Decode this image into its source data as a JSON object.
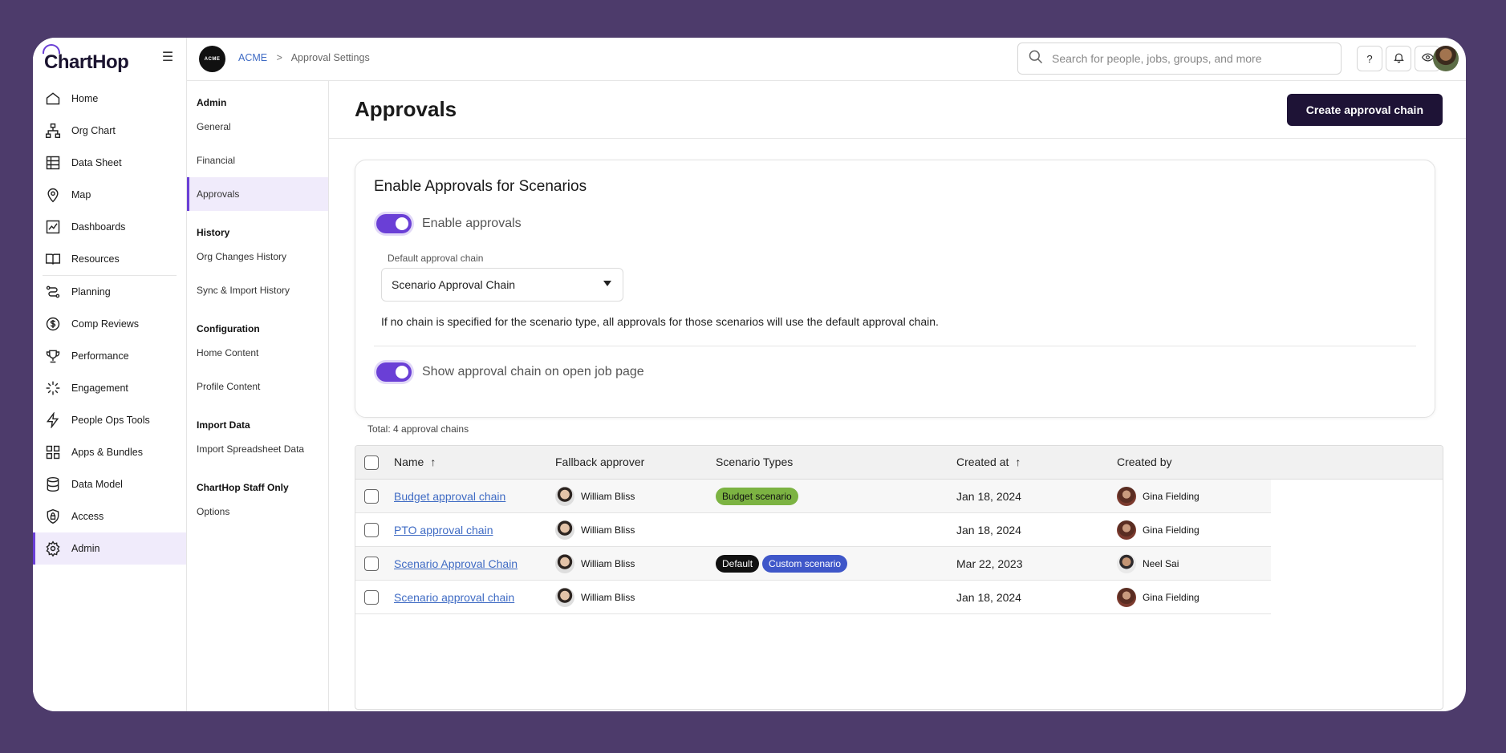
{
  "brand": {
    "name": "ChartHop"
  },
  "leftnav": {
    "items": [
      {
        "label": "Home",
        "icon": "home-icon"
      },
      {
        "label": "Org Chart",
        "icon": "org-chart-icon"
      },
      {
        "label": "Data Sheet",
        "icon": "data-sheet-icon"
      },
      {
        "label": "Map",
        "icon": "map-pin-icon"
      },
      {
        "label": "Dashboards",
        "icon": "dashboard-icon"
      },
      {
        "label": "Resources",
        "icon": "book-icon"
      },
      {
        "label": "Planning",
        "icon": "planning-icon"
      },
      {
        "label": "Comp Reviews",
        "icon": "dollar-icon"
      },
      {
        "label": "Performance",
        "icon": "trophy-icon"
      },
      {
        "label": "Engagement",
        "icon": "sparkle-icon"
      },
      {
        "label": "People Ops Tools",
        "icon": "bolt-icon"
      },
      {
        "label": "Apps & Bundles",
        "icon": "apps-icon"
      },
      {
        "label": "Data Model",
        "icon": "database-icon"
      },
      {
        "label": "Access",
        "icon": "lock-icon"
      },
      {
        "label": "Admin",
        "icon": "gear-icon"
      }
    ],
    "active": "Admin"
  },
  "org": {
    "logo_text": "ACME"
  },
  "breadcrumb": {
    "org": "ACME",
    "separator": ">",
    "page": "Approval Settings"
  },
  "search": {
    "placeholder": "Search for people, jobs, groups, and more"
  },
  "topbar": {
    "help_label": "?"
  },
  "subnav": {
    "sections": [
      {
        "heading": "Admin",
        "items": [
          "General",
          "Financial",
          "Approvals"
        ]
      },
      {
        "heading": "History",
        "items": [
          "Org Changes History",
          "Sync & Import History"
        ]
      },
      {
        "heading": "Configuration",
        "items": [
          "Home Content",
          "Profile Content"
        ]
      },
      {
        "heading": "Import Data",
        "items": [
          "Import Spreadsheet Data"
        ]
      },
      {
        "heading": "ChartHop Staff Only",
        "items": [
          "Options"
        ]
      }
    ],
    "active": "Approvals"
  },
  "page": {
    "title": "Approvals",
    "create_button": "Create approval chain"
  },
  "settings": {
    "title": "Enable Approvals for Scenarios",
    "enable_label": "Enable approvals",
    "enable_on": true,
    "default_chain_label": "Default approval chain",
    "default_chain_value": "Scenario Approval Chain",
    "help_text": "If no chain is specified for the scenario type, all approvals for those scenarios will use the default approval chain.",
    "show_chain_label": "Show approval chain on open job page",
    "show_chain_on": true
  },
  "table": {
    "total": "Total: 4 approval chains",
    "columns": [
      "Name",
      "Fallback approver",
      "Scenario Types",
      "Created at",
      "Created by"
    ],
    "rows": [
      {
        "name": "Budget approval chain",
        "fallback": "William Bliss",
        "tags": [
          {
            "label": "Budget scenario",
            "color": "#7cb342"
          }
        ],
        "created_at": "Jan 18, 2024",
        "created_by": "Gina Fielding"
      },
      {
        "name": "PTO approval chain",
        "fallback": "William Bliss",
        "tags": [],
        "created_at": "Jan 18, 2024",
        "created_by": "Gina Fielding"
      },
      {
        "name": "Scenario Approval Chain",
        "fallback": "William Bliss",
        "tags": [
          {
            "label": "Default",
            "color": "#111111"
          },
          {
            "label": "Custom scenario",
            "color": "#3f57c9"
          }
        ],
        "created_at": "Mar 22, 2023",
        "created_by": "Neel Sai"
      },
      {
        "name": "Scenario approval chain",
        "fallback": "William Bliss",
        "tags": [],
        "created_at": "Jan 18, 2024",
        "created_by": "Gina Fielding"
      }
    ]
  },
  "colors": {
    "accent": "#6a3fd6",
    "primary_button": "#1e1336",
    "link": "#3f6bc4",
    "background": "#4d3b6b"
  }
}
